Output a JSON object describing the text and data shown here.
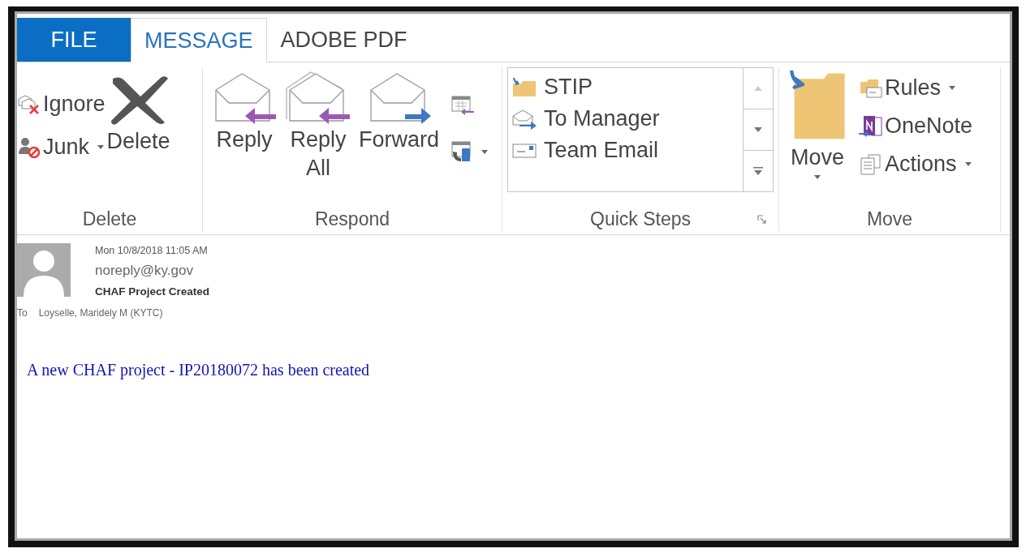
{
  "tabs": [
    {
      "label": "FILE",
      "kind": "backstage",
      "selected": false
    },
    {
      "label": "MESSAGE",
      "kind": "tab",
      "selected": true
    },
    {
      "label": "ADOBE PDF",
      "kind": "tab",
      "selected": false
    }
  ],
  "ribbon": {
    "delete": {
      "label": "Delete",
      "small": [
        {
          "label": "Ignore",
          "dropdown": false
        },
        {
          "label": "Junk",
          "dropdown": true
        }
      ],
      "large": {
        "label": "Delete"
      }
    },
    "respond": {
      "label": "Respond",
      "large": [
        {
          "label": "Reply"
        },
        {
          "label": "Reply All"
        },
        {
          "label": "Forward"
        }
      ],
      "small": [
        {
          "dropdown": false
        },
        {
          "dropdown": true
        }
      ]
    },
    "quick_steps": {
      "label": "Quick Steps",
      "steps": [
        {
          "label": "STIP"
        },
        {
          "label": "To Manager"
        },
        {
          "label": "Team Email"
        }
      ]
    },
    "move": {
      "label": "Move",
      "large": {
        "label": "Move",
        "dropdown": true
      },
      "small": [
        {
          "label": "Rules",
          "dropdown": true
        },
        {
          "label": "OneNote",
          "dropdown": false
        },
        {
          "label": "Actions",
          "dropdown": true
        }
      ]
    }
  },
  "message": {
    "date": "Mon 10/8/2018 11:05 AM",
    "sender": "noreply@ky.gov",
    "subject": "CHAF Project Created",
    "to_label": "To",
    "recipient": "Loyselle, Maridely M (KYTC)",
    "body": "A new CHAF project - IP20180072 has been created"
  }
}
